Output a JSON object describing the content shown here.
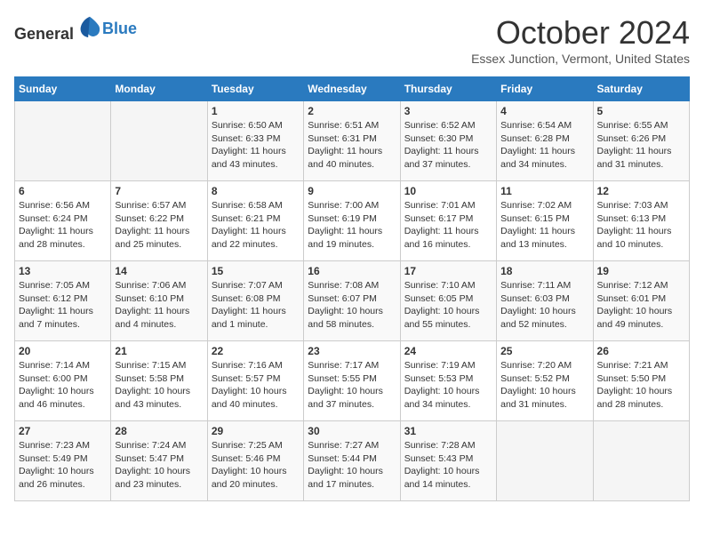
{
  "header": {
    "logo_general": "General",
    "logo_blue": "Blue",
    "month_title": "October 2024",
    "location": "Essex Junction, Vermont, United States"
  },
  "days_of_week": [
    "Sunday",
    "Monday",
    "Tuesday",
    "Wednesday",
    "Thursday",
    "Friday",
    "Saturday"
  ],
  "weeks": [
    [
      {
        "day": "",
        "sunrise": "",
        "sunset": "",
        "daylight": ""
      },
      {
        "day": "",
        "sunrise": "",
        "sunset": "",
        "daylight": ""
      },
      {
        "day": "1",
        "sunrise": "Sunrise: 6:50 AM",
        "sunset": "Sunset: 6:33 PM",
        "daylight": "Daylight: 11 hours and 43 minutes."
      },
      {
        "day": "2",
        "sunrise": "Sunrise: 6:51 AM",
        "sunset": "Sunset: 6:31 PM",
        "daylight": "Daylight: 11 hours and 40 minutes."
      },
      {
        "day": "3",
        "sunrise": "Sunrise: 6:52 AM",
        "sunset": "Sunset: 6:30 PM",
        "daylight": "Daylight: 11 hours and 37 minutes."
      },
      {
        "day": "4",
        "sunrise": "Sunrise: 6:54 AM",
        "sunset": "Sunset: 6:28 PM",
        "daylight": "Daylight: 11 hours and 34 minutes."
      },
      {
        "day": "5",
        "sunrise": "Sunrise: 6:55 AM",
        "sunset": "Sunset: 6:26 PM",
        "daylight": "Daylight: 11 hours and 31 minutes."
      }
    ],
    [
      {
        "day": "6",
        "sunrise": "Sunrise: 6:56 AM",
        "sunset": "Sunset: 6:24 PM",
        "daylight": "Daylight: 11 hours and 28 minutes."
      },
      {
        "day": "7",
        "sunrise": "Sunrise: 6:57 AM",
        "sunset": "Sunset: 6:22 PM",
        "daylight": "Daylight: 11 hours and 25 minutes."
      },
      {
        "day": "8",
        "sunrise": "Sunrise: 6:58 AM",
        "sunset": "Sunset: 6:21 PM",
        "daylight": "Daylight: 11 hours and 22 minutes."
      },
      {
        "day": "9",
        "sunrise": "Sunrise: 7:00 AM",
        "sunset": "Sunset: 6:19 PM",
        "daylight": "Daylight: 11 hours and 19 minutes."
      },
      {
        "day": "10",
        "sunrise": "Sunrise: 7:01 AM",
        "sunset": "Sunset: 6:17 PM",
        "daylight": "Daylight: 11 hours and 16 minutes."
      },
      {
        "day": "11",
        "sunrise": "Sunrise: 7:02 AM",
        "sunset": "Sunset: 6:15 PM",
        "daylight": "Daylight: 11 hours and 13 minutes."
      },
      {
        "day": "12",
        "sunrise": "Sunrise: 7:03 AM",
        "sunset": "Sunset: 6:13 PM",
        "daylight": "Daylight: 11 hours and 10 minutes."
      }
    ],
    [
      {
        "day": "13",
        "sunrise": "Sunrise: 7:05 AM",
        "sunset": "Sunset: 6:12 PM",
        "daylight": "Daylight: 11 hours and 7 minutes."
      },
      {
        "day": "14",
        "sunrise": "Sunrise: 7:06 AM",
        "sunset": "Sunset: 6:10 PM",
        "daylight": "Daylight: 11 hours and 4 minutes."
      },
      {
        "day": "15",
        "sunrise": "Sunrise: 7:07 AM",
        "sunset": "Sunset: 6:08 PM",
        "daylight": "Daylight: 11 hours and 1 minute."
      },
      {
        "day": "16",
        "sunrise": "Sunrise: 7:08 AM",
        "sunset": "Sunset: 6:07 PM",
        "daylight": "Daylight: 10 hours and 58 minutes."
      },
      {
        "day": "17",
        "sunrise": "Sunrise: 7:10 AM",
        "sunset": "Sunset: 6:05 PM",
        "daylight": "Daylight: 10 hours and 55 minutes."
      },
      {
        "day": "18",
        "sunrise": "Sunrise: 7:11 AM",
        "sunset": "Sunset: 6:03 PM",
        "daylight": "Daylight: 10 hours and 52 minutes."
      },
      {
        "day": "19",
        "sunrise": "Sunrise: 7:12 AM",
        "sunset": "Sunset: 6:01 PM",
        "daylight": "Daylight: 10 hours and 49 minutes."
      }
    ],
    [
      {
        "day": "20",
        "sunrise": "Sunrise: 7:14 AM",
        "sunset": "Sunset: 6:00 PM",
        "daylight": "Daylight: 10 hours and 46 minutes."
      },
      {
        "day": "21",
        "sunrise": "Sunrise: 7:15 AM",
        "sunset": "Sunset: 5:58 PM",
        "daylight": "Daylight: 10 hours and 43 minutes."
      },
      {
        "day": "22",
        "sunrise": "Sunrise: 7:16 AM",
        "sunset": "Sunset: 5:57 PM",
        "daylight": "Daylight: 10 hours and 40 minutes."
      },
      {
        "day": "23",
        "sunrise": "Sunrise: 7:17 AM",
        "sunset": "Sunset: 5:55 PM",
        "daylight": "Daylight: 10 hours and 37 minutes."
      },
      {
        "day": "24",
        "sunrise": "Sunrise: 7:19 AM",
        "sunset": "Sunset: 5:53 PM",
        "daylight": "Daylight: 10 hours and 34 minutes."
      },
      {
        "day": "25",
        "sunrise": "Sunrise: 7:20 AM",
        "sunset": "Sunset: 5:52 PM",
        "daylight": "Daylight: 10 hours and 31 minutes."
      },
      {
        "day": "26",
        "sunrise": "Sunrise: 7:21 AM",
        "sunset": "Sunset: 5:50 PM",
        "daylight": "Daylight: 10 hours and 28 minutes."
      }
    ],
    [
      {
        "day": "27",
        "sunrise": "Sunrise: 7:23 AM",
        "sunset": "Sunset: 5:49 PM",
        "daylight": "Daylight: 10 hours and 26 minutes."
      },
      {
        "day": "28",
        "sunrise": "Sunrise: 7:24 AM",
        "sunset": "Sunset: 5:47 PM",
        "daylight": "Daylight: 10 hours and 23 minutes."
      },
      {
        "day": "29",
        "sunrise": "Sunrise: 7:25 AM",
        "sunset": "Sunset: 5:46 PM",
        "daylight": "Daylight: 10 hours and 20 minutes."
      },
      {
        "day": "30",
        "sunrise": "Sunrise: 7:27 AM",
        "sunset": "Sunset: 5:44 PM",
        "daylight": "Daylight: 10 hours and 17 minutes."
      },
      {
        "day": "31",
        "sunrise": "Sunrise: 7:28 AM",
        "sunset": "Sunset: 5:43 PM",
        "daylight": "Daylight: 10 hours and 14 minutes."
      },
      {
        "day": "",
        "sunrise": "",
        "sunset": "",
        "daylight": ""
      },
      {
        "day": "",
        "sunrise": "",
        "sunset": "",
        "daylight": ""
      }
    ]
  ]
}
